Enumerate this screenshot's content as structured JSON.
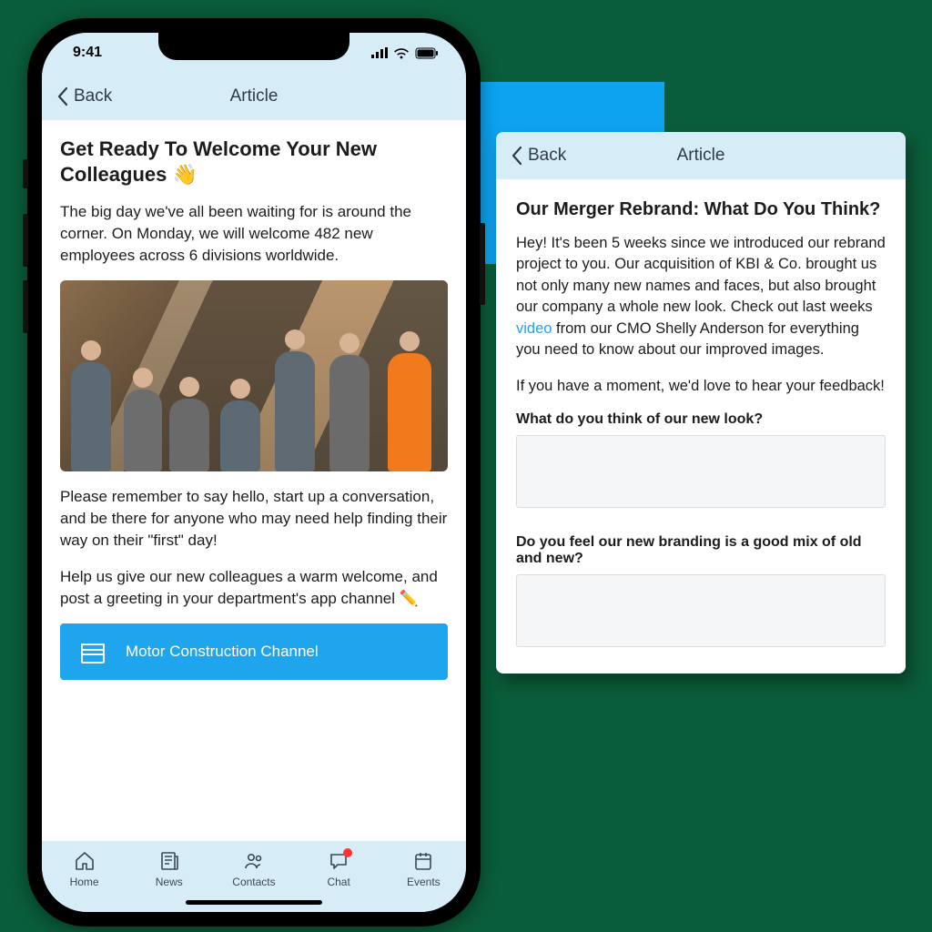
{
  "status": {
    "time": "9:41"
  },
  "phone_article": {
    "nav": {
      "back": "Back",
      "title": "Article"
    },
    "title": "Get Ready To Welcome Your New Colleagues 👋",
    "p1": "The big day we've all been waiting for is around the corner. On Monday, we will welcome 482 new employees across 6 divisions worldwide.",
    "p2": "Please remember to say hello, start up a conversation, and be there for anyone who may need help finding their way on their \"first\" day!",
    "p3": "Help us give our new colleagues a warm welcome, and post a greeting in your department's app channel ✏️",
    "channel_button": "Motor Construction Channel"
  },
  "tabs": {
    "home": "Home",
    "news": "News",
    "contacts": "Contacts",
    "chat": "Chat",
    "events": "Events"
  },
  "card": {
    "nav": {
      "back": "Back",
      "title": "Article"
    },
    "title": "Our Merger Rebrand: What Do You Think?",
    "p1a": "Hey! It's been 5 weeks since we introduced our rebrand project to you. Our acquisition of KBI & Co. brought us not only many new names and faces, but also brought our company a whole new look. Check out last weeks ",
    "link": "video",
    "p1b": " from our CMO Shelly Anderson for everything you need to know about our improved images.",
    "p2": "If you have a moment, we'd love to hear your feedback!",
    "q1": "What do you think of our new look?",
    "q2": "Do you feel our new branding is a good mix of old and new?"
  }
}
